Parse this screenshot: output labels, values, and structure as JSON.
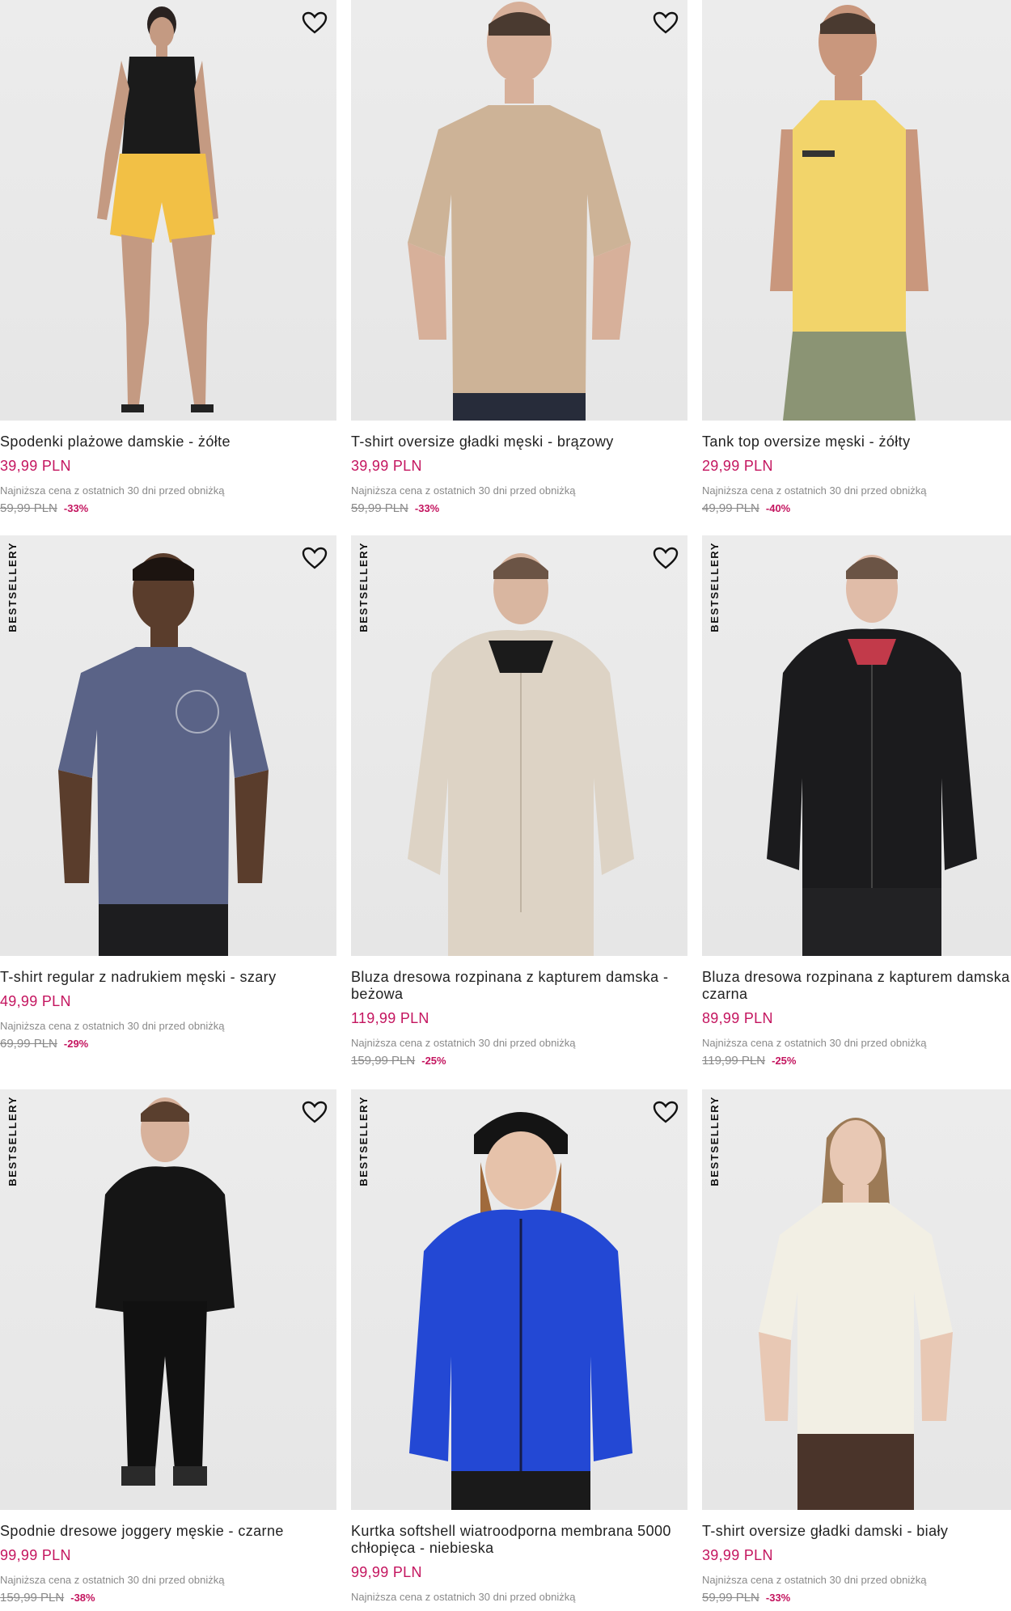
{
  "badge_label": "BESTSELLERY",
  "lowest_price_note": "Najniższa cena z ostatnich 30 dni przed obniżką",
  "accent_color": "#c4155f",
  "products": [
    {
      "name": "Spodenki plażowe damskie - żółte",
      "price": "39,99 PLN",
      "old_price": "59,99 PLN",
      "discount": "-33%",
      "bestseller": false
    },
    {
      "name": "T-shirt oversize gładki męski - brązowy",
      "price": "39,99 PLN",
      "old_price": "59,99 PLN",
      "discount": "-33%",
      "bestseller": false
    },
    {
      "name": "Tank top oversize męski - żółty",
      "price": "29,99 PLN",
      "old_price": "49,99 PLN",
      "discount": "-40%",
      "bestseller": false
    },
    {
      "name": "T-shirt regular z nadrukiem męski - szary",
      "price": "49,99 PLN",
      "old_price": "69,99 PLN",
      "discount": "-29%",
      "bestseller": true
    },
    {
      "name": "Bluza dresowa rozpinana z kapturem damska - beżowa",
      "price": "119,99 PLN",
      "old_price": "159,99 PLN",
      "discount": "-25%",
      "bestseller": true
    },
    {
      "name": "Bluza dresowa rozpinana z kapturem damska - czarna",
      "price": "89,99 PLN",
      "old_price": "119,99 PLN",
      "discount": "-25%",
      "bestseller": true
    },
    {
      "name": "Spodnie dresowe joggery męskie - czarne",
      "price": "99,99 PLN",
      "old_price": "159,99 PLN",
      "discount": "-38%",
      "bestseller": true
    },
    {
      "name": "Kurtka softshell wiatroodporna membrana 5000 chłopięca - niebieska",
      "price": "99,99 PLN",
      "old_price": "",
      "discount": "",
      "bestseller": true
    },
    {
      "name": "T-shirt oversize gładki damski - biały",
      "price": "39,99 PLN",
      "old_price": "59,99 PLN",
      "discount": "-33%",
      "bestseller": true
    }
  ]
}
